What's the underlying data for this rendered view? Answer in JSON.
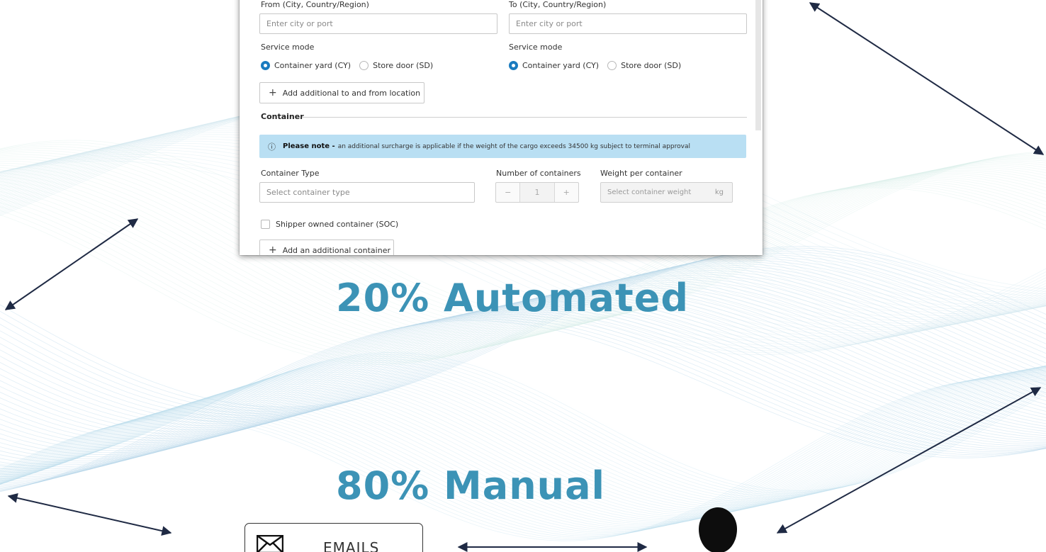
{
  "form": {
    "from_label": "From (City, Country/Region)",
    "to_label": "To (City, Country/Region)",
    "from_placeholder": "Enter city or port",
    "to_placeholder": "Enter city or port",
    "origin_service_mode_label": "Service mode",
    "destination_service_mode_label": "Service mode",
    "origin_mode_options": [
      "Container yard (CY)",
      "Store door (SD)"
    ],
    "destination_mode_options": [
      "Container yard (CY)",
      "Store door (SD)"
    ],
    "origin_mode_selected": "Container yard (CY)",
    "destination_mode_selected": "Container yard (CY)",
    "add_location_button": "Add additional to and from location",
    "container_section_title": "Container",
    "note_title": "Please note -",
    "note_text": "an additional surcharge is applicable if the weight of the cargo exceeds 34500 kg subject to terminal approval",
    "container_type_label": "Container Type",
    "container_type_placeholder": "Select container type",
    "number_of_containers_label": "Number of containers",
    "number_of_containers_value": "1",
    "stepper_minus": "−",
    "stepper_plus": "+",
    "weight_label": "Weight per container",
    "weight_placeholder": "Select container weight",
    "weight_unit": "kg",
    "soc_label": "Shipper owned container (SOC)",
    "soc_checked": false,
    "add_container_button": "Add an additional container"
  },
  "headline_automated": "20% Automated",
  "headline_manual": "80% Manual",
  "emails_label": "EMAILS",
  "icons": {
    "info": "info-icon",
    "plus": "plus-icon",
    "envelope": "envelope-icon",
    "person": "person-head-icon"
  },
  "colors": {
    "headline": "#3c93b6",
    "radio_selected": "#1a7bbf",
    "note_background": "#b9dff3",
    "arrow": "#1f2a44"
  }
}
